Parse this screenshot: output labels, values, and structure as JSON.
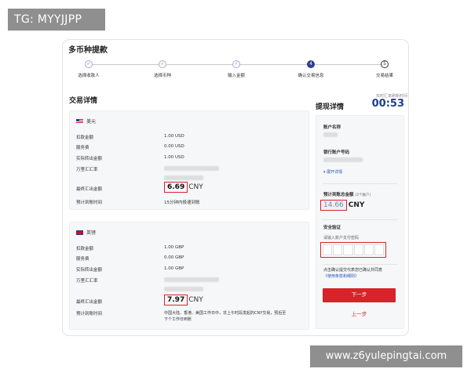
{
  "banner": {
    "text": "TG: MYYJJPP"
  },
  "watermark": {
    "text": "www.z6yulepingtai.com"
  },
  "page": {
    "title": "多币种提款"
  },
  "steps": [
    {
      "label": "选择收款人",
      "state": "done",
      "symbol": "✓"
    },
    {
      "label": "选择币种",
      "state": "done",
      "symbol": "✓"
    },
    {
      "label": "输入金额",
      "state": "done",
      "symbol": "✓"
    },
    {
      "label": "确认交易信息",
      "state": "active",
      "symbol": "4"
    },
    {
      "label": "交易结果",
      "state": "todo",
      "symbol": "5"
    }
  ],
  "details": {
    "title": "交易详情",
    "usd": {
      "currency": "美元",
      "rows": [
        {
          "label": "扣款金额",
          "value": "1.00 USD"
        },
        {
          "label": "服务费",
          "value": "0.00 USD"
        },
        {
          "label": "实际转出金额",
          "value": "1.00 USD"
        },
        {
          "label": "万里汇汇率",
          "value": ""
        }
      ],
      "final_label": "最终汇出金额",
      "final_amount": "6.69",
      "final_unit": "CNY",
      "eta_label": "预计到账时间",
      "eta_value": "15分钟内极速到账"
    },
    "gbp": {
      "currency": "英镑",
      "rows": [
        {
          "label": "扣款金额",
          "value": "1.00 GBP"
        },
        {
          "label": "服务费",
          "value": "0.00 GBP"
        },
        {
          "label": "实际转出金额",
          "value": "1.00 GBP"
        },
        {
          "label": "万里汇汇率",
          "value": ""
        }
      ],
      "final_label": "最终汇出金额",
      "final_amount": "7.97",
      "final_unit": "CNY",
      "eta_label": "预计到账时间",
      "eta_line1": "中国大陆、香港、美国工作日中，非上午时段发起的CNY交易，预后至",
      "eta_line2": "下个工作日到账"
    }
  },
  "withdraw": {
    "title": "提现详情",
    "countdown_caption": "实时汇率刷新时间",
    "countdown": "00:53",
    "account_name_label": "账户名称",
    "bank_account_label": "银行账户号码",
    "expand_link": "▾ 展开详情",
    "total_label": "预计到账总金额",
    "total_hint": "(2个账户)",
    "total_amount": "14.66",
    "total_unit": "CNY",
    "security_label": "安全验证",
    "pin_hint": "请输入账户支付密码",
    "agree_text": "点击确认提交代表您已确认并同意",
    "terms_link": "《使用条款和细则》",
    "next_label": "下一步",
    "prev_label": "上一步"
  },
  "colors": {
    "accent": "#d8232a",
    "brand": "#1d3d8f"
  }
}
